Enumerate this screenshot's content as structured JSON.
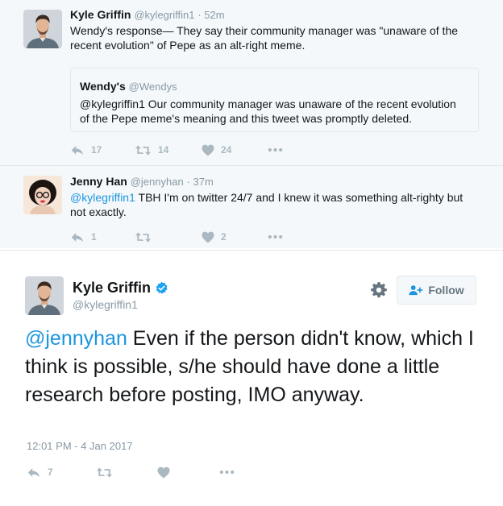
{
  "tweets": [
    {
      "name": "Kyle Griffin",
      "handle": "@kylegriffin1",
      "time": "· 52m",
      "text_line1": "Wendy's response— They say their community manager was \"unaware of the",
      "text_line2": "recent evolution\" of Pepe as an alt-right meme.",
      "quote": {
        "name": "Wendy's",
        "handle": "@Wendys",
        "text_line1": "@kylegriffin1 Our community manager was unaware of the recent evolution",
        "text_line2": "of the Pepe meme's meaning and this tweet was promptly deleted."
      },
      "actions": {
        "reply": "17",
        "retweet": "14",
        "like": "24"
      }
    },
    {
      "name": "Jenny Han",
      "handle": "@jennyhan",
      "time": "· 37m",
      "mention": "@kylegriffin1",
      "text_line1_rest": " TBH I'm on twitter 24/7 and I knew it was something alt-righty but",
      "text_line2": "not exactly.",
      "actions": {
        "reply": "1",
        "retweet": "",
        "like": "2"
      }
    }
  ],
  "main": {
    "name": "Kyle Griffin",
    "handle": "@kylegriffin1",
    "follow_label": "Follow",
    "mention": "@jennyhan",
    "text_rest": " Even if the person didn't know, which I think is possible, s/he should have done a little research before posting, IMO anyway.",
    "timestamp": "12:01 PM - 4 Jan 2017",
    "actions": {
      "reply": "7",
      "retweet": "",
      "like": ""
    }
  },
  "colors": {
    "link": "#1b95e0",
    "muted": "#8899a6",
    "icon": "#aab8c2",
    "verified": "#1da1f2"
  }
}
